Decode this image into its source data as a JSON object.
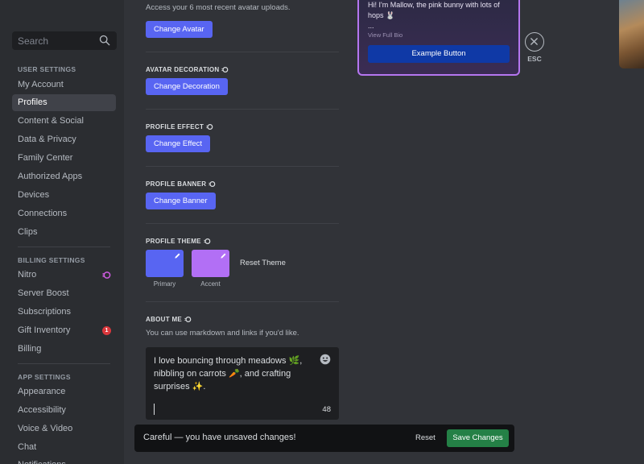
{
  "sidebar": {
    "search_placeholder": "Search",
    "sections": {
      "user": "USER SETTINGS",
      "billing": "BILLING SETTINGS",
      "app": "APP SETTINGS"
    },
    "user_items": [
      "My Account",
      "Profiles",
      "Content & Social",
      "Data & Privacy",
      "Family Center",
      "Authorized Apps",
      "Devices",
      "Connections",
      "Clips"
    ],
    "billing_items": [
      "Nitro",
      "Server Boost",
      "Subscriptions",
      "Gift Inventory",
      "Billing"
    ],
    "app_items": [
      "Appearance",
      "Accessibility",
      "Voice & Video",
      "Chat",
      "Notifications"
    ],
    "active_item": "Profiles",
    "gift_badge": "1"
  },
  "main": {
    "avatar_desc": "Access your 6 most recent avatar uploads.",
    "change_avatar": "Change Avatar",
    "avatar_decoration_label": "AVATAR DECORATION",
    "change_decoration": "Change Decoration",
    "profile_effect_label": "PROFILE EFFECT",
    "change_effect": "Change Effect",
    "profile_banner_label": "PROFILE BANNER",
    "change_banner": "Change Banner",
    "profile_theme_label": "PROFILE THEME",
    "primary_label": "Primary",
    "accent_label": "Accent",
    "reset_theme": "Reset Theme",
    "about_me_label": "ABOUT ME",
    "about_me_desc": "You can use markdown and links if you'd like.",
    "about_me_text": "I love bouncing through meadows 🌿, nibbling on carrots 🥕, and crafting surprises ✨.",
    "char_count": "48"
  },
  "colors": {
    "primary": "#5865f2",
    "accent": "#b26ff5",
    "nitro": "#d05ce3"
  },
  "preview": {
    "bio": "Hi! I'm Mallow, the pink bunny with lots of hops 🐰",
    "ellipsis": "...",
    "view_full_bio": "View Full Bio",
    "example_button": "Example Button"
  },
  "close": {
    "esc_label": "ESC"
  },
  "unsaved_bar": {
    "message": "Careful — you have unsaved changes!",
    "reset": "Reset",
    "save": "Save Changes"
  }
}
